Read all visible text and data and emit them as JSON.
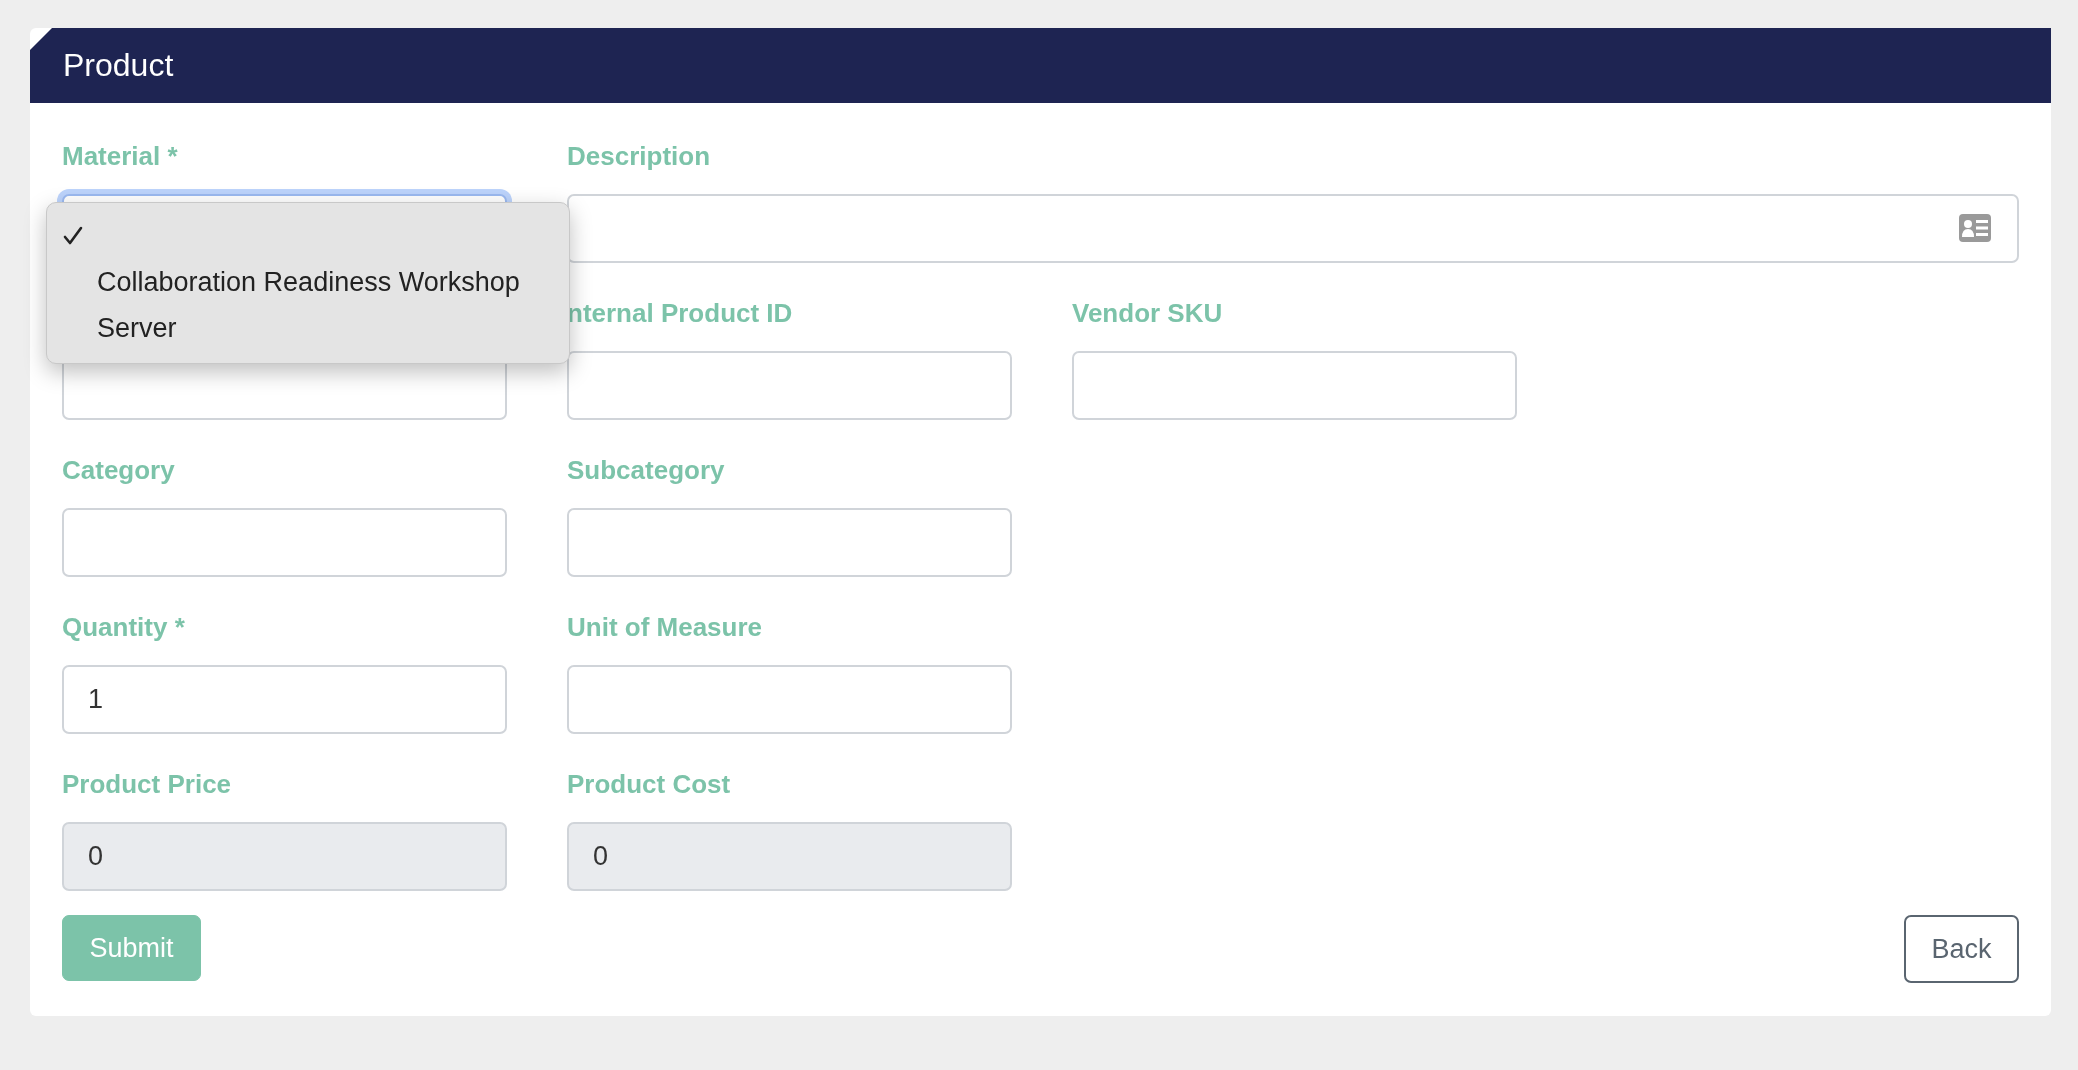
{
  "panel": {
    "title": "Product"
  },
  "fields": [
    {
      "kind": "select",
      "label": "Material *",
      "focused": true,
      "open": true,
      "options": [
        {
          "selected": true
        },
        {
          "label": "Collaboration Readiness Workshop",
          "selected": false
        },
        {
          "label": "Server",
          "selected": false
        }
      ]
    },
    {
      "kind": "icon-text",
      "label": "Description"
    },
    {
      "kind": "text"
    },
    {
      "kind": "text",
      "label": "nternal Product ID"
    },
    {
      "kind": "text",
      "label": "Vendor SKU"
    },
    {
      "kind": "break"
    },
    {
      "kind": "text",
      "label": "Category"
    },
    {
      "kind": "text",
      "label": "Subcategory"
    },
    {
      "kind": "break"
    },
    {
      "kind": "text",
      "label": "Quantity *",
      "value": "1"
    },
    {
      "kind": "text",
      "label": "Unit of Measure"
    },
    {
      "kind": "break"
    },
    {
      "kind": "readonly",
      "label": "Product Price",
      "value": "0"
    },
    {
      "kind": "readonly",
      "label": "Product Cost",
      "value": "0"
    }
  ],
  "buttons": [
    {
      "kind": "primary",
      "label": "Submit"
    },
    {
      "kind": "outline",
      "label": "Back"
    }
  ]
}
